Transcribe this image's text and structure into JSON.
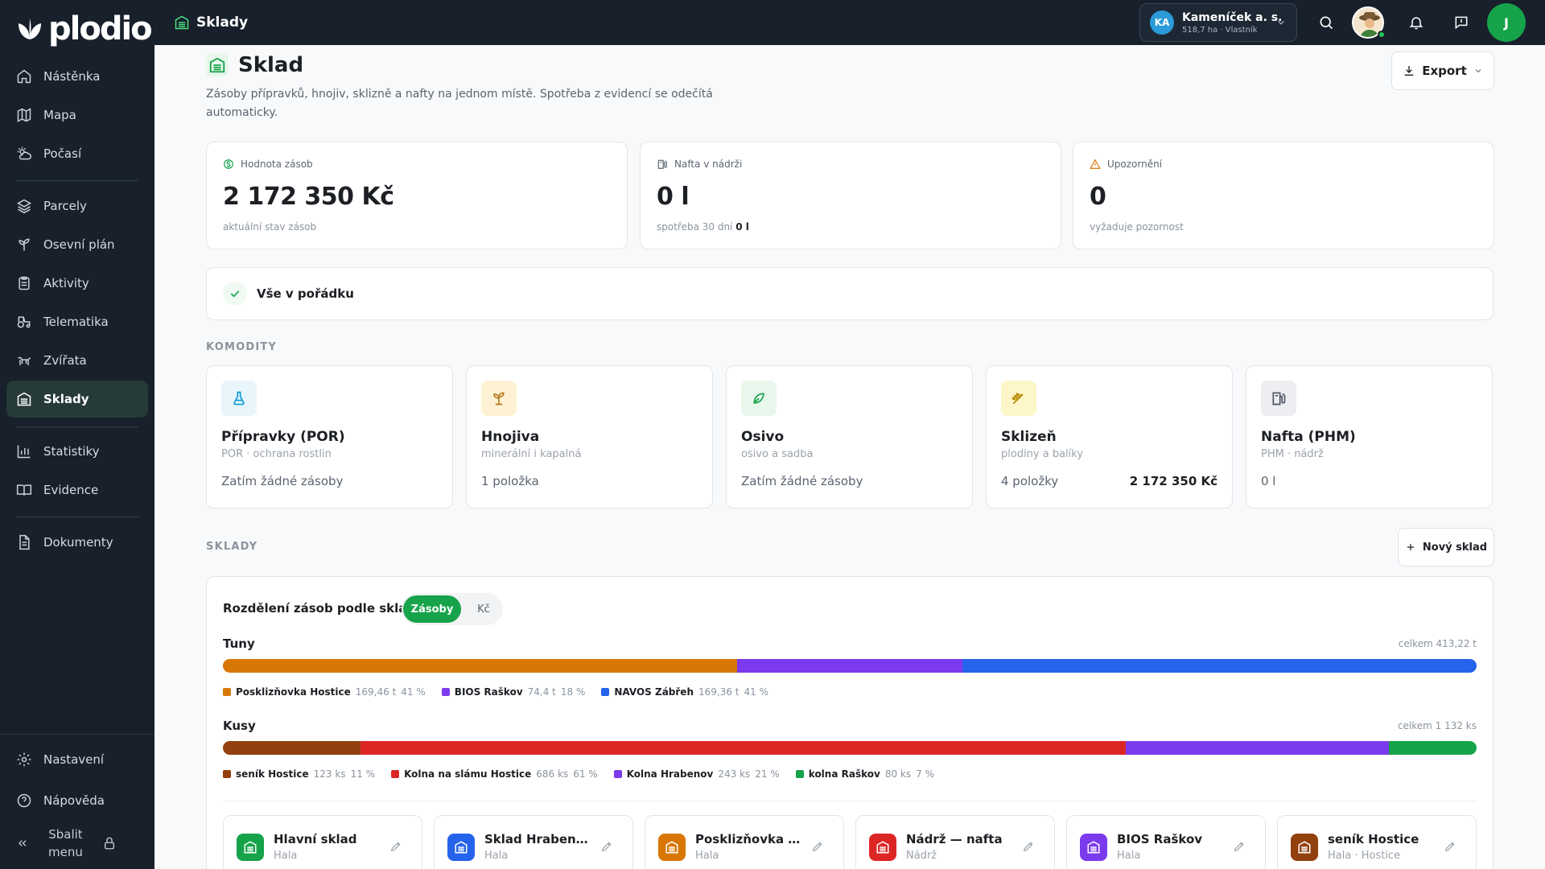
{
  "brand": {
    "name": "plodio"
  },
  "sidebar": {
    "items": [
      {
        "label": "Nástěnka",
        "icon": "home-icon"
      },
      {
        "label": "Mapa",
        "icon": "map-icon"
      },
      {
        "label": "Počasí",
        "icon": "weather-icon"
      },
      {
        "label": "Parcely",
        "icon": "layers-icon"
      },
      {
        "label": "Osevní plán",
        "icon": "sprout-icon"
      },
      {
        "label": "Aktivity",
        "icon": "clipboard-icon"
      },
      {
        "label": "Telematika",
        "icon": "tractor-icon"
      },
      {
        "label": "Zvířata",
        "icon": "animal-icon"
      },
      {
        "label": "Sklady",
        "icon": "warehouse-icon",
        "active": true
      },
      {
        "label": "Statistiky",
        "icon": "bar-chart-icon"
      },
      {
        "label": "Evidence",
        "icon": "book-icon"
      },
      {
        "label": "Dokumenty",
        "icon": "document-icon"
      }
    ],
    "settings": "Nastavení",
    "help": "Nápověda",
    "collapse_line1": "Sbalit",
    "collapse_line2": "menu"
  },
  "topbar": {
    "page": "Sklady",
    "company": {
      "initials": "KA",
      "name": "Kameníček a. s.",
      "sub": "518,7 ha · Vlastník"
    },
    "user_initial": "J"
  },
  "header": {
    "title": "Sklad",
    "description": "Zásoby přípravků, hnojiv, sklizně a nafty na jednom místě. Spotřeba z evidencí se odečítá automaticky.",
    "export": "Export"
  },
  "stats": [
    {
      "label": "Hodnota zásob",
      "value": "2 172 350 Kč",
      "sub": "aktuální stav zásob",
      "sub_bold": "",
      "icon": "dollar-icon",
      "color": "#16a34a"
    },
    {
      "label": "Nafta v nádrži",
      "value": "0 l",
      "sub": "spotřeba 30 dní ",
      "sub_bold": "0 l",
      "icon": "fuel-icon",
      "color": "#5b6470"
    },
    {
      "label": "Upozornění",
      "value": "0",
      "sub": "vyžaduje pozornost",
      "sub_bold": "",
      "icon": "warning-icon",
      "color": "#d97706"
    }
  ],
  "status": {
    "text": "Vše v pořádku"
  },
  "sections": {
    "commodities": "KOMODITY",
    "warehouses": "SKLADY"
  },
  "commodities": [
    {
      "title": "Přípravky (POR)",
      "sub": "POR · ochrana rostlin",
      "count": "Zatím žádné zásoby",
      "value": "",
      "icon": "flask-icon",
      "bg": "#e8f6fc",
      "fg": "#0e9fd3"
    },
    {
      "title": "Hnojiva",
      "sub": "minerální i kapalná",
      "count": "1 položka",
      "value": "",
      "icon": "sprout-icon",
      "bg": "#fdf2d3",
      "fg": "#b7791f"
    },
    {
      "title": "Osivo",
      "sub": "osivo a sadba",
      "count": "Zatím žádné zásoby",
      "value": "",
      "icon": "seed-icon",
      "bg": "#e7f7ec",
      "fg": "#16a34a"
    },
    {
      "title": "Sklizeň",
      "sub": "plodiny a balíky",
      "count": "4 položky",
      "value": "2 172 350 Kč",
      "icon": "wheat-icon",
      "bg": "#fdf6c9",
      "fg": "#b58a00"
    },
    {
      "title": "Nafta (PHM)",
      "sub": "PHM · nádrž",
      "count": "0 l",
      "value": "",
      "icon": "fuel-icon",
      "bg": "#eceef1",
      "fg": "#4b5563"
    }
  ],
  "new_warehouse": "Nový sklad",
  "distribution": {
    "title": "Rozdělení zásob podle skladů",
    "toggle_on": "Zásoby",
    "toggle_off": "Kč",
    "groups": [
      {
        "label": "Tuny",
        "total": "celkem 413,22 t",
        "items": [
          {
            "name": "Posklizňovka Hostice",
            "qty": "169,46 t",
            "pct": "41 %",
            "share": 41,
            "color": "#d97706"
          },
          {
            "name": "BIOS Raškov",
            "qty": "74,4 t",
            "pct": "18 %",
            "share": 18,
            "color": "#7c3aed"
          },
          {
            "name": "NAVOS Zábřeh",
            "qty": "169,36 t",
            "pct": "41 %",
            "share": 41,
            "color": "#2563eb"
          }
        ]
      },
      {
        "label": "Kusy",
        "total": "celkem 1 132 ks",
        "items": [
          {
            "name": "seník Hostice",
            "qty": "123 ks",
            "pct": "11 %",
            "share": 11,
            "color": "#92400e"
          },
          {
            "name": "Kolna na slámu Hostice",
            "qty": "686 ks",
            "pct": "61 %",
            "share": 61,
            "color": "#dc2626"
          },
          {
            "name": "Kolna Hrabenov",
            "qty": "243 ks",
            "pct": "21 %",
            "share": 21,
            "color": "#7c3aed"
          },
          {
            "name": "kolna Raškov",
            "qty": "80 ks",
            "pct": "7 %",
            "share": 7,
            "color": "#16a34a"
          }
        ]
      }
    ]
  },
  "warehouses": [
    {
      "name": "Hlavní sklad",
      "type": "Hala",
      "color": "#16a34a"
    },
    {
      "name": "Sklad Hraben…",
      "type": "Hala",
      "color": "#2563eb"
    },
    {
      "name": "Posklizňovka …",
      "type": "Hala",
      "color": "#d97706"
    },
    {
      "name": "Nádrž — nafta",
      "type": "Nádrž",
      "color": "#dc2626"
    },
    {
      "name": "BIOS Raškov",
      "type": "Hala",
      "color": "#7c3aed"
    },
    {
      "name": "seník Hostice",
      "type": "Hala · Hostice",
      "color": "#92400e"
    }
  ]
}
